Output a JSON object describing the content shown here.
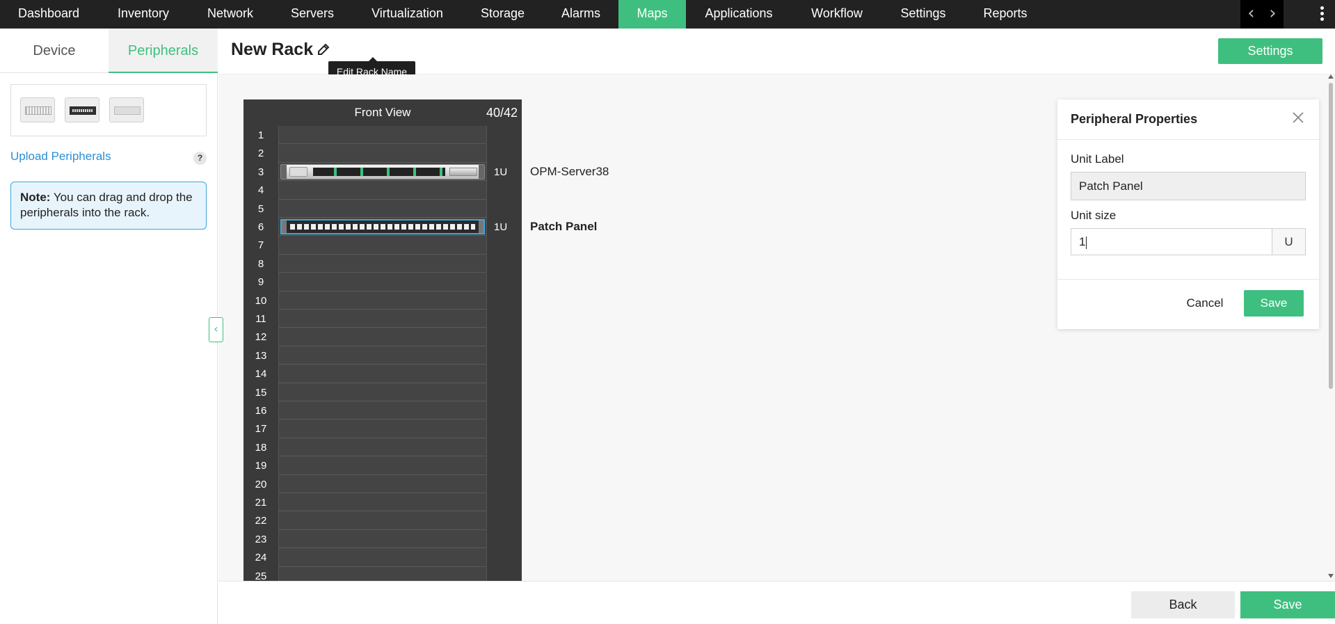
{
  "nav": {
    "items": [
      {
        "label": "Dashboard"
      },
      {
        "label": "Inventory"
      },
      {
        "label": "Network"
      },
      {
        "label": "Servers"
      },
      {
        "label": "Virtualization"
      },
      {
        "label": "Storage"
      },
      {
        "label": "Alarms"
      },
      {
        "label": "Maps"
      },
      {
        "label": "Applications"
      },
      {
        "label": "Workflow"
      },
      {
        "label": "Settings"
      },
      {
        "label": "Reports"
      }
    ],
    "active": "Maps",
    "prev_icon": "chevron-left-icon",
    "next_icon": "chevron-right-icon",
    "prev_glyph": "‹",
    "next_glyph": "›",
    "more_icon": "kebab-icon"
  },
  "sidebar": {
    "tabs": [
      {
        "label": "Device"
      },
      {
        "label": "Peripherals"
      }
    ],
    "active_tab": "Peripherals",
    "peripheral_thumbs": [
      "cable-manager",
      "patch-panel",
      "blank-panel"
    ],
    "upload_label": "Upload Peripherals",
    "help_glyph": "?",
    "note_bold": "Note:",
    "note_text": "You can drag and drop the peripherals into the rack.",
    "collapse_glyph": "‹"
  },
  "header": {
    "title": "New Rack",
    "edit_tooltip": "Edit Rack Name",
    "settings_label": "Settings"
  },
  "rack": {
    "view_title": "Front View",
    "capacity": "40/42",
    "visible_units": [
      "1",
      "2",
      "3",
      "4",
      "5",
      "6",
      "7",
      "8",
      "9",
      "10",
      "11",
      "12",
      "13",
      "14",
      "15",
      "16",
      "17",
      "18",
      "19",
      "20",
      "21",
      "22",
      "23",
      "24",
      "25"
    ],
    "devices": [
      {
        "unit": 3,
        "size": "1U",
        "label": "OPM-Server38",
        "type": "server",
        "bold": false
      },
      {
        "unit": 6,
        "size": "1U",
        "label": "Patch Panel",
        "type": "patch-panel",
        "bold": true
      }
    ]
  },
  "properties": {
    "title": "Peripheral Properties",
    "unit_label_caption": "Unit Label",
    "unit_label_value": "Patch Panel",
    "unit_size_caption": "Unit size",
    "unit_size_value": "1",
    "unit_suffix": "U",
    "cancel_label": "Cancel",
    "save_label": "Save"
  },
  "footer": {
    "back_label": "Back",
    "save_label": "Save"
  },
  "colors": {
    "accent": "#3fbf7f",
    "nav_bg": "#222222",
    "link": "#2b8fd6",
    "rack_bg": "#3a3a3a"
  }
}
